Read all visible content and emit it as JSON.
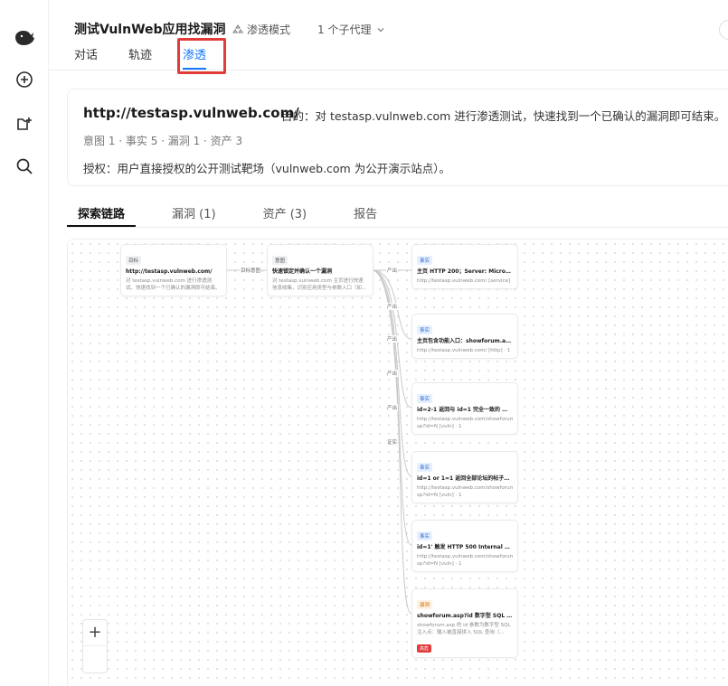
{
  "header": {
    "title": "测试VulnWeb应用找漏洞",
    "mode_label": "渗透模式",
    "agents_label": "1 个子代理",
    "tabs": [
      {
        "label": "对话"
      },
      {
        "label": "轨迹"
      },
      {
        "label": "渗透"
      }
    ],
    "active_tab": "渗透"
  },
  "target": {
    "url": "http://testasp.vulnweb.com/",
    "goal": "目的：对 testasp.vulnweb.com 进行渗透测试，快速找到一个已确认的漏洞即可结束。",
    "stats": "意图 1 · 事实 5 · 漏洞 1 · 资产 3",
    "auth": "授权：用户直接授权的公开测试靶场（vulnweb.com 为公开演示站点）。"
  },
  "subtabs": [
    {
      "label": "探索链路"
    },
    {
      "label": "漏洞 (1)"
    },
    {
      "label": "资产 (3)"
    },
    {
      "label": "报告"
    }
  ],
  "graph": {
    "nodes": {
      "target": {
        "tag": "目标",
        "title": "http://testasp.vulnweb.com/",
        "sub": "对 testasp.vulnweb.com 进行渗透测试，快速找到一个已确认的漏洞即可结束。"
      },
      "intent": {
        "tag": "意图",
        "title": "快速锁定并确认一个漏洞",
        "sub": "对 testasp.vulnweb.com 主页进行快速信息收集，识别应用类型与参数入口（如..."
      },
      "f1": {
        "tag": "事实",
        "title": "主页 HTTP 200；Server: Microsoft-IIS...",
        "sub": "http://testasp.vulnweb.com/ [service] · 1"
      },
      "f2": {
        "tag": "事实",
        "title": "主页包含功能入口：showforum.asp?i...",
        "sub": "http://testasp.vulnweb.com/ [http] · 1"
      },
      "f3": {
        "tag": "事实",
        "title": "id=2-1 返回与 id=1 完全一致的 Weath...",
        "sub": "http://testasp.vulnweb.com/showforum.a sp?id=N [vuln] · 1"
      },
      "f4": {
        "tag": "事实",
        "title": "id=1 or 1=1 返回全部论坛的帖子列表...",
        "sub": "http://testasp.vulnweb.com/showforum.a sp?id=N [vuln] · 1"
      },
      "f5": {
        "tag": "事实",
        "title": "id=1' 触发 HTTP 500 Internal Server E...",
        "sub": "http://testasp.vulnweb.com/showforum.a sp?id=N [vuln] · 1"
      },
      "v1": {
        "tag": "漏洞",
        "title": "showforum.asp?id 数字型 SQL 注入（...",
        "sub": "showforum.asp 的 id 参数为数字型 SQL 注入点：输入被直接拼入 SQL 查询（...",
        "badge": "高危"
      }
    },
    "edge_labels": {
      "e0": "目标意图",
      "e1": "产出",
      "e2": "产出",
      "e3": "产出",
      "e4": "产出",
      "e5": "产出",
      "e6": "证实"
    }
  },
  "zoom": {
    "plus": "+"
  }
}
